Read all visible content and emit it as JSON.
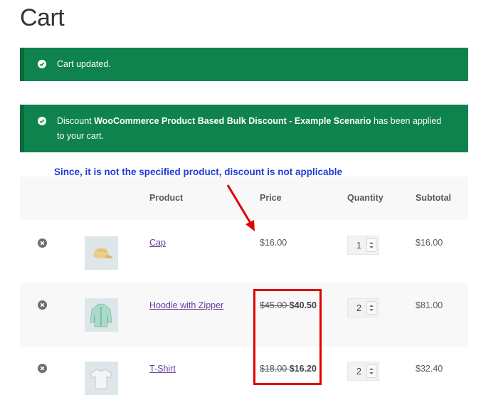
{
  "page": {
    "title": "Cart"
  },
  "notices": {
    "updated": "Cart updated.",
    "discount": {
      "prefix": "Discount ",
      "name": "WooCommerce Product Based Bulk Discount - Example Scenario",
      "suffix": " has been applied to your cart."
    }
  },
  "annotation": "Since, it is not the specified product, discount is not applicable",
  "table": {
    "headers": {
      "product": "Product",
      "price": "Price",
      "quantity": "Quantity",
      "subtotal": "Subtotal"
    },
    "rows": [
      {
        "name": "Cap",
        "old_price": "",
        "price": "$16.00",
        "quantity": "1",
        "subtotal": "$16.00",
        "thumb_icon": "cap-icon"
      },
      {
        "name": "Hoodie with Zipper",
        "old_price": "$45.00",
        "price": "$40.50",
        "quantity": "2",
        "subtotal": "$81.00",
        "thumb_icon": "hoodie-icon"
      },
      {
        "name": "T-Shirt",
        "old_price": "$18.00",
        "price": "$16.20",
        "quantity": "2",
        "subtotal": "$32.40",
        "thumb_icon": "tshirt-icon"
      }
    ]
  },
  "colors": {
    "notice_bg": "#0f834d",
    "annotation": "#1e3dd6",
    "highlight": "#e00000",
    "link": "#6a3d9a"
  }
}
